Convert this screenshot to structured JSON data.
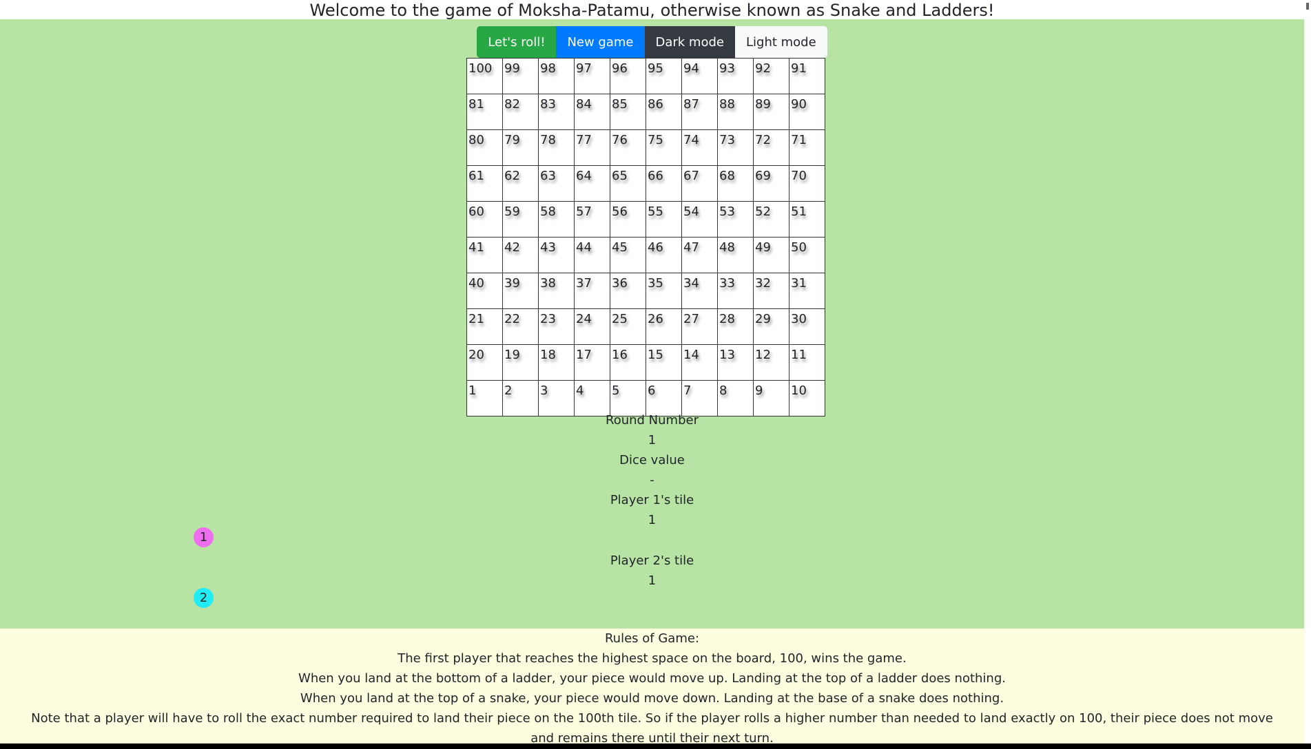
{
  "title": "Welcome to the game of Moksha-Patamu, otherwise known as Snake and Ladders!",
  "controls": {
    "roll": "Let's roll!",
    "new_game": "New game",
    "dark_mode": "Dark mode",
    "light_mode": "Light mode"
  },
  "board": [
    [
      "100",
      "99",
      "98",
      "97",
      "96",
      "95",
      "94",
      "93",
      "92",
      "91"
    ],
    [
      "81",
      "82",
      "83",
      "84",
      "85",
      "86",
      "87",
      "88",
      "89",
      "90"
    ],
    [
      "80",
      "79",
      "78",
      "77",
      "76",
      "75",
      "74",
      "73",
      "72",
      "71"
    ],
    [
      "61",
      "62",
      "63",
      "64",
      "65",
      "66",
      "67",
      "68",
      "69",
      "70"
    ],
    [
      "60",
      "59",
      "58",
      "57",
      "56",
      "55",
      "54",
      "53",
      "52",
      "51"
    ],
    [
      "41",
      "42",
      "43",
      "44",
      "45",
      "46",
      "47",
      "48",
      "49",
      "50"
    ],
    [
      "40",
      "39",
      "38",
      "37",
      "36",
      "35",
      "34",
      "33",
      "32",
      "31"
    ],
    [
      "21",
      "22",
      "23",
      "24",
      "25",
      "26",
      "27",
      "28",
      "29",
      "30"
    ],
    [
      "20",
      "19",
      "18",
      "17",
      "16",
      "15",
      "14",
      "13",
      "12",
      "11"
    ],
    [
      "1",
      "2",
      "3",
      "4",
      "5",
      "6",
      "7",
      "8",
      "9",
      "10"
    ]
  ],
  "stats": {
    "round_label": "Round Number",
    "round_value": "1",
    "dice_label": "Dice value",
    "dice_value": "-",
    "p1_label": "Player 1's tile",
    "p1_value": "1",
    "p2_label": "Player 2's tile",
    "p2_value": "1"
  },
  "tokens": {
    "p1": {
      "label": "1",
      "color": "#ee6ef0"
    },
    "p2": {
      "label": "2",
      "color": "#22ecf3"
    }
  },
  "colors": {
    "game_bg": "#b7e4a5",
    "rules_bg": "#fdfddf"
  },
  "rules": {
    "heading": "Rules of Game:",
    "lines": [
      "The first player that reaches the highest space on the board, 100, wins the game.",
      "When you land at the bottom of a ladder, your piece would move up. Landing at the top of a ladder does nothing.",
      "When you land at the top of a snake, your piece would move down. Landing at the base of a snake does nothing.",
      "Note that a player will have to roll the exact number required to land their piece on the 100th tile. So if the player rolls a higher number than needed to land exactly on 100, their piece does not move and remains there until their next turn."
    ]
  }
}
